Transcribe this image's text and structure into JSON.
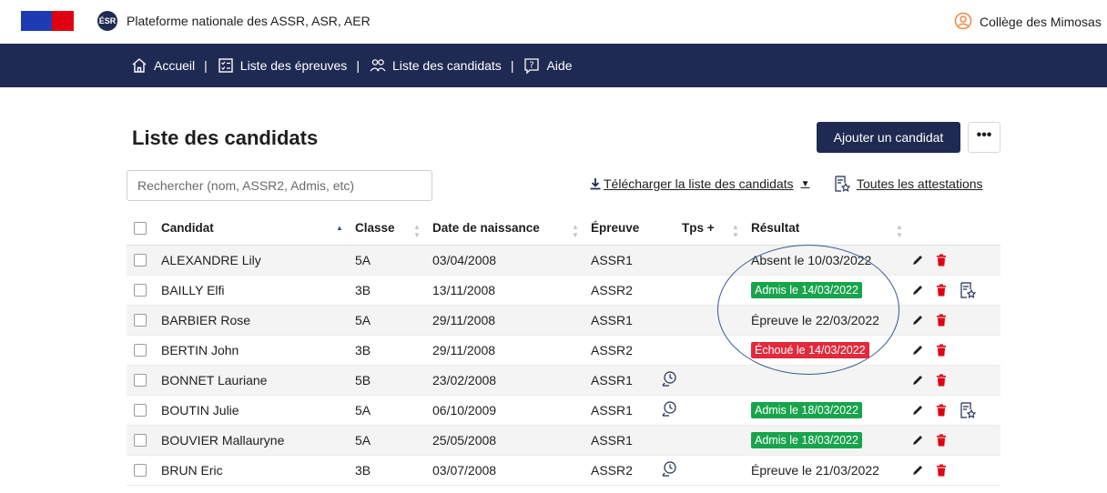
{
  "header": {
    "platform_title": "Plateforme nationale des ASSR, ASR, AER",
    "esr_logo": "ÉSR",
    "user_name": "Collège des Mimosas",
    "flag_colors": [
      "#1f3bb3",
      "#e1000f"
    ]
  },
  "nav": {
    "items": [
      {
        "label": "Accueil",
        "icon": "home-icon"
      },
      {
        "label": "Liste des épreuves",
        "icon": "checklist-icon"
      },
      {
        "label": "Liste des candidats",
        "icon": "people-icon"
      },
      {
        "label": "Aide",
        "icon": "help-icon"
      }
    ],
    "separator": "|"
  },
  "page": {
    "title": "Liste des candidats",
    "add_button": "Ajouter un candidat",
    "more_button": "•••",
    "search_placeholder": "Rechercher (nom, ASSR2, Admis, etc)",
    "download_label": "Télécharger la liste des candidats",
    "all_attestations_label": "Toutes les attestations"
  },
  "table": {
    "headers": {
      "candidate": "Candidat",
      "class": "Classe",
      "dob": "Date de naissance",
      "test": "Épreuve",
      "extra_time": "Tps +",
      "result": "Résultat"
    },
    "rows": [
      {
        "name": "ALEXANDRE Lily",
        "class": "5A",
        "dob": "03/04/2008",
        "test": "ASSR1",
        "extra_time": false,
        "result": "Absent le 10/03/2022",
        "status": "plain",
        "attestation": false
      },
      {
        "name": "BAILLY Elfi",
        "class": "3B",
        "dob": "13/11/2008",
        "test": "ASSR2",
        "extra_time": false,
        "result": "Admis le 14/03/2022",
        "status": "green",
        "attestation": true
      },
      {
        "name": "BARBIER Rose",
        "class": "5A",
        "dob": "29/11/2008",
        "test": "ASSR1",
        "extra_time": false,
        "result": "Épreuve le 22/03/2022",
        "status": "plain",
        "attestation": false
      },
      {
        "name": "BERTIN John",
        "class": "3B",
        "dob": "29/11/2008",
        "test": "ASSR2",
        "extra_time": false,
        "result": "Échoué le 14/03/2022",
        "status": "red",
        "attestation": false
      },
      {
        "name": "BONNET Lauriane",
        "class": "5B",
        "dob": "23/02/2008",
        "test": "ASSR1",
        "extra_time": true,
        "result": "",
        "status": "plain",
        "attestation": false
      },
      {
        "name": "BOUTIN Julie",
        "class": "5A",
        "dob": "06/10/2009",
        "test": "ASSR1",
        "extra_time": true,
        "result": "Admis le 18/03/2022",
        "status": "green",
        "attestation": true
      },
      {
        "name": "BOUVIER Mallauryne",
        "class": "5A",
        "dob": "25/05/2008",
        "test": "ASSR1",
        "extra_time": false,
        "result": "Admis le 18/03/2022",
        "status": "green",
        "attestation": false
      },
      {
        "name": "BRUN Eric",
        "class": "3B",
        "dob": "03/07/2008",
        "test": "ASSR2",
        "extra_time": true,
        "result": "Épreuve le 21/03/2022",
        "status": "plain",
        "attestation": false
      }
    ]
  },
  "colors": {
    "navy": "#1f2a52",
    "success": "#18a44c",
    "danger": "#e12a3c",
    "delete_icon": "#e1000f",
    "user_icon": "#f08a4b"
  }
}
